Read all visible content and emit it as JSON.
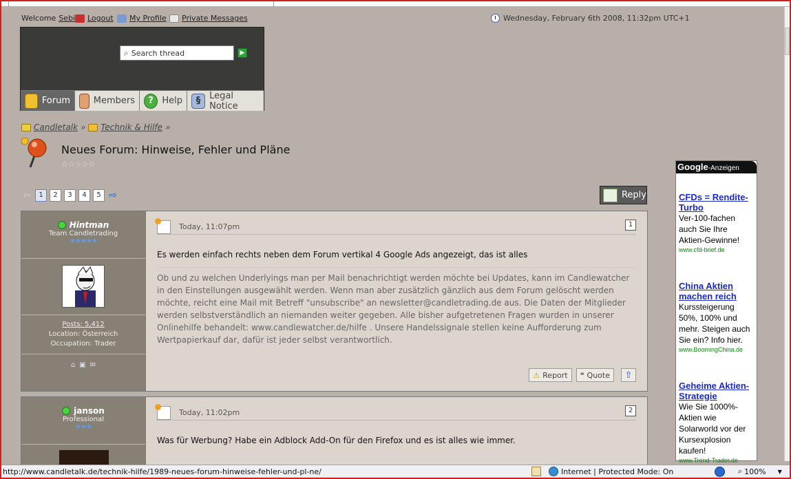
{
  "topbar": {
    "welcome_prefix": "Welcome",
    "username": "Sebi",
    "logout": "Logout",
    "profile": "My Profile",
    "messages": "Private Messages",
    "date": "Wednesday, February 6th 2008, 11:32pm UTC+1"
  },
  "header": {
    "search_placeholder": "Search thread",
    "tabs": [
      {
        "label": "Forum",
        "icon": "folder-icon"
      },
      {
        "label": "Members",
        "icon": "members-icon"
      },
      {
        "label": "Help",
        "icon": "help-icon"
      },
      {
        "label": "Legal Notice",
        "icon": "paragraph-icon"
      }
    ]
  },
  "breadcrumb": [
    "Candletalk",
    "Technik & Hilfe"
  ],
  "thread": {
    "title": "Neues Forum: Hinweise, Fehler und Pläne",
    "rating_stars": "☆☆☆☆☆"
  },
  "pagination": {
    "pages": [
      "1",
      "2",
      "3",
      "4",
      "5"
    ],
    "current": "1"
  },
  "reply_label": "Reply",
  "posts": [
    {
      "author": "Hintman",
      "rank": "Team Candletrading",
      "stars": "★★★★★",
      "posts": "Posts: 5,412",
      "location": "Location: Österreich",
      "occupation": "Occupation: Trader",
      "time": "Today, 11:07pm",
      "number": "1",
      "title": "Es werden einfach rechts neben dem Forum vertikal 4 Google Ads angezeigt, das ist alles",
      "body": "Ob und zu welchen Underlyings man per Mail benachrichtigt werden möchte bei Updates, kann im Candlewatcher in den Einstellungen ausgewählt werden. Wenn man aber zusätzlich gänzlich aus dem Forum gelöscht werden möchte, reicht eine Mail mit Betreff \"unsubscribe\" an newsletter@candletrading.de aus. Die Daten der Mitglieder werden selbstverständlich an niemanden weiter gegeben. Alle bisher aufgetretenen Fragen wurden in unserer Onlinehilfe behandelt: www.candlewatcher.de/hilfe . Unsere Handelssignale stellen keine Aufforderung zum Wertpapierkauf dar, dafür ist jeder selbst verantwortlich.",
      "report": "Report",
      "quote": "Quote"
    },
    {
      "author": "janson",
      "rank": "Professional",
      "stars": "★★★",
      "time": "Today, 11:02pm",
      "number": "2",
      "title": "Was für Werbung? Habe ein Adblock Add-On für den Firefox und es ist alles wie immer."
    }
  ],
  "ads": {
    "header_google": "Google",
    "header_label": "-Anzeigen",
    "items": [
      {
        "title": "CFDs = Rendite-Turbo",
        "desc": "Ver-100-fachen auch Sie Ihre Aktien-Gewinne!",
        "url": "www.cfd-brief.de"
      },
      {
        "title": "China Aktien machen reich",
        "desc": "Kurssteigerung 50%, 100% und mehr. Steigen auch Sie ein? Info hier.",
        "url": "www.BoomingChina.de"
      },
      {
        "title": "Geheime Aktien-Strategie",
        "desc": "Wie Sie 1000%-Aktien wie Solarworld vor der Kursexplosion kaufen!",
        "url": "www.Trend-Trader.de"
      }
    ]
  },
  "statusbar": {
    "url": "http://www.candletalk.de/technik-hilfe/1989-neues-forum-hinweise-fehler-und-pl-ne/",
    "zone": "Internet | Protected Mode: On",
    "zoom": "100%"
  },
  "colors": {
    "background": "#b8afa8",
    "user_panel": "#878075",
    "post_bg": "#dcd5cd",
    "ad_link": "#1a28c8",
    "ad_url": "#0a8a0a"
  }
}
